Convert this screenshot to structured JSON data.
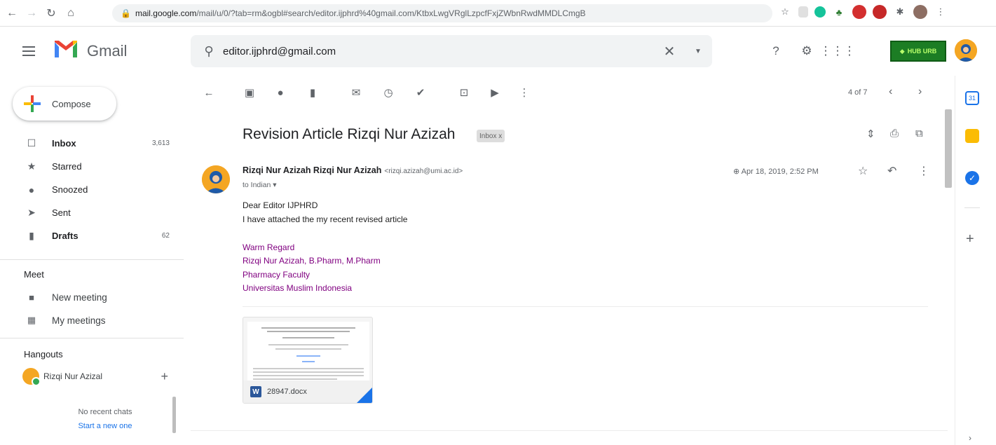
{
  "browser": {
    "url_host": "mail.google.com",
    "url_path": "/mail/u/0/?tab=rm&ogbl#search/editor.ijphrd%40gmail.com/KtbxLwgVRglLzpcfFxjZWbnRwdMMDLCmgB"
  },
  "header": {
    "app_name": "Gmail",
    "search_value": "editor.ijphrd@gmail.com",
    "brand_badge_text": "HUB URB"
  },
  "sidebar": {
    "compose_label": "Compose",
    "items": [
      {
        "label": "Inbox",
        "count": "3,613",
        "icon": "inbox-icon"
      },
      {
        "label": "Starred",
        "count": "",
        "icon": "star-icon"
      },
      {
        "label": "Snoozed",
        "count": "",
        "icon": "clock-icon"
      },
      {
        "label": "Sent",
        "count": "",
        "icon": "send-icon"
      },
      {
        "label": "Drafts",
        "count": "62",
        "icon": "draft-icon"
      }
    ],
    "meet_title": "Meet",
    "meet_items": [
      "New meeting",
      "My meetings"
    ],
    "hangouts_title": "Hangouts",
    "hangouts_user": "Rizqi Nur Azizal",
    "no_chats": "No recent chats",
    "start_new": "Start a new one"
  },
  "toolbar": {
    "pager": "4 of 7"
  },
  "message": {
    "subject": "Revision Article Rizqi Nur Azizah",
    "label_chip": "Inbox x",
    "sender_name": "Rizqi Nur Azizah Rizqi Nur Azizah",
    "sender_email": "<rizqi.azizah@umi.ac.id>",
    "to": "to Indian",
    "date": "Apr 18, 2019, 2:52 PM",
    "body": [
      "Dear Editor IJPHRD",
      "I have attached the my recent revised article"
    ],
    "signature": [
      "Warm Regard",
      "Rizqi Nur Azizah, B.Pharm, M.Pharm",
      "Pharmacy Faculty",
      "Universitas Muslim Indonesia"
    ],
    "attachment_name": "28947.docx"
  }
}
